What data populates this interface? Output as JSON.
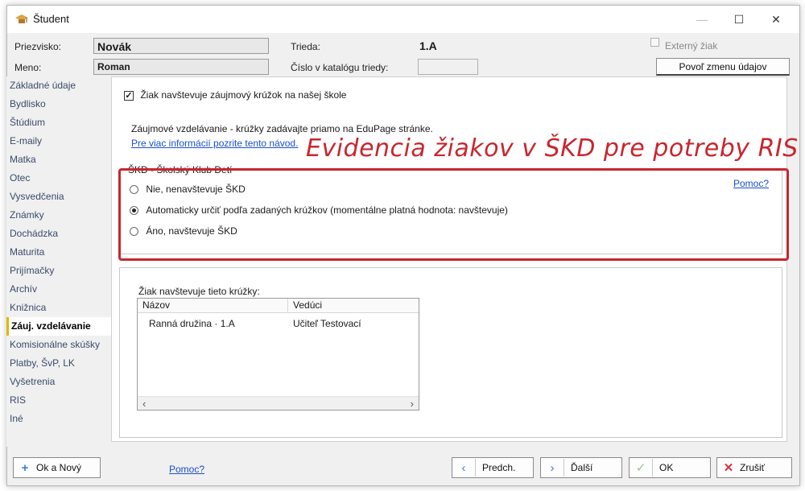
{
  "window": {
    "title": "Študent"
  },
  "header": {
    "surname_label": "Priezvisko:",
    "surname_value": "Novák",
    "name_label": "Meno:",
    "name_value": "Roman",
    "class_label": "Trieda:",
    "class_value": "1.A",
    "catalog_label": "Číslo v katalógu triedy:",
    "catalog_value": "",
    "external_label": "Externý žiak",
    "allow_change_label": "Povoľ zmenu údajov"
  },
  "nav": {
    "items": [
      {
        "label": "Základné údaje"
      },
      {
        "label": "Bydlisko"
      },
      {
        "label": "Štúdium"
      },
      {
        "label": "E-maily"
      },
      {
        "label": "Matka"
      },
      {
        "label": "Otec"
      },
      {
        "label": "Vysvedčenia"
      },
      {
        "label": "Známky"
      },
      {
        "label": "Dochádzka"
      },
      {
        "label": "Maturita"
      },
      {
        "label": "Prijímačky"
      },
      {
        "label": "Archív"
      },
      {
        "label": "Knižnica"
      },
      {
        "label": "Záuj. vzdelávanie"
      },
      {
        "label": "Komisionálne skúšky"
      },
      {
        "label": "Platby, ŠvP, LK"
      },
      {
        "label": "Vyšetrenia"
      },
      {
        "label": "RIS"
      },
      {
        "label": "Iné"
      }
    ],
    "active_index": 13
  },
  "content": {
    "attends_checkbox_label": "Žiak navštevuje záujmový krúžok na našej škole",
    "attends_checked": true,
    "info_text": "Záujmové vzdelávanie - krúžky zadávajte priamo na EduPage stránke.",
    "info_link": "Pre viac informácií pozrite tento návod.",
    "annotation": "Evidencia žiakov v ŠKD pre potreby RIS",
    "skd_legend": "ŠKD - Školský Klub Detí",
    "skd_help": "Pomoc?",
    "skd_options": [
      {
        "label": "Nie, nenavštevuje ŠKD",
        "selected": false
      },
      {
        "label": "Automaticky určiť podľa zadaných krúžkov (momentálne platná hodnota: navštevuje)",
        "selected": true
      },
      {
        "label": "Áno, navštevuje ŠKD",
        "selected": false
      }
    ],
    "clubs_label": "Žiak navštevuje tieto krúžky:",
    "clubs_columns": [
      "Názov",
      "Vedúci"
    ],
    "clubs_rows": [
      {
        "name": "Ranná družina · 1.A",
        "leader": "Učiteľ Testovací"
      }
    ]
  },
  "footer": {
    "ok_new": "Ok a Nový",
    "help": "Pomoc?",
    "prev": "Predch.",
    "next": "Ďalší",
    "ok": "OK",
    "cancel": "Zrušiť"
  },
  "colors": {
    "annotation_red": "#c8262e",
    "link_blue": "#1a4fd0",
    "active_marker": "#e0b800"
  }
}
